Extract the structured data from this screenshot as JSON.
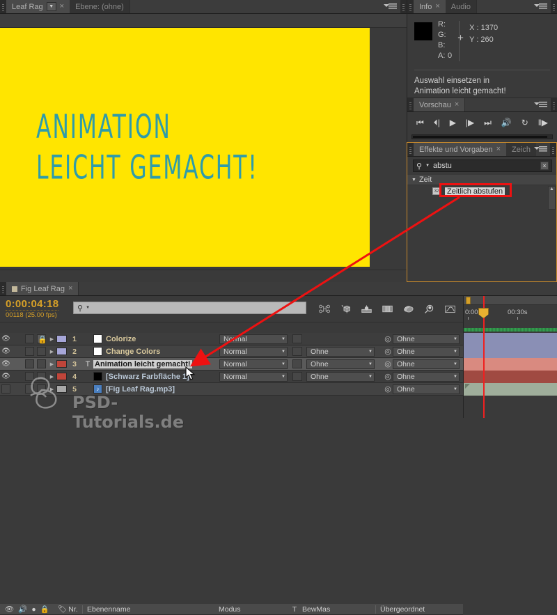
{
  "viewer": {
    "comp_tab": "Leaf Rag",
    "layer_tab": "Ebene: (ohne)",
    "close_glyph": "×",
    "caret_glyph": "▼",
    "comp_text_line1": "ANIMATION",
    "comp_text_line2": "LEICHT GEMACHT!",
    "bg_color": "#FFE500",
    "text_color": "#2E9CAA"
  },
  "info": {
    "tab": "Info",
    "tab_audio": "Audio",
    "close_glyph": "×",
    "r_label": "R:",
    "g_label": "G:",
    "b_label": "B:",
    "a_label": "A:",
    "r_value": "",
    "g_value": "",
    "b_value": "",
    "a_value": "0",
    "x_value": "X : 1370",
    "y_value": "Y : 260",
    "cross_glyph": "+",
    "message_line1": "Auswahl einsetzen in",
    "message_line2": "Animation leicht gemacht!",
    "swatch_color": "#000000"
  },
  "preview": {
    "tab": "Vorschau",
    "close_glyph": "×",
    "buttons": [
      {
        "name": "first-frame",
        "glyph": "⏮"
      },
      {
        "name": "prev-frame",
        "glyph": "⏴|"
      },
      {
        "name": "play",
        "glyph": "▶"
      },
      {
        "name": "next-frame",
        "glyph": "|▶"
      },
      {
        "name": "last-frame",
        "glyph": "⏭"
      },
      {
        "name": "audio",
        "glyph": "🔊"
      },
      {
        "name": "loop",
        "glyph": "↻"
      },
      {
        "name": "ram-preview",
        "glyph": "‖▶"
      }
    ]
  },
  "effects": {
    "tab": "Effekte und Vorgaben",
    "tab_inactive": "Zeich",
    "close_glyph": "×",
    "search_value": "abstu",
    "search_icon": "⚲",
    "search_caret": "▼",
    "clear_glyph": "×",
    "category": "Zeit",
    "category_tri": "▼",
    "item_name": "Zeitlich abstufen",
    "item_icon": "32",
    "scroll_up": "▲"
  },
  "timeline": {
    "tab": "Fig Leaf Rag",
    "close_glyph": "×",
    "timecode": "0:00:04:18",
    "frames": "00118 (25.00 fps)",
    "search_icon": "⚲",
    "search_caret": "▼",
    "search_value": "",
    "switch_icons": [
      "composition-nesting-icon",
      "draft-3d-icon",
      "motion-blur-icon",
      "frame-blending-icon",
      "shy-icon",
      "graph-editor-icon",
      "curve-editor-icon"
    ],
    "columns": {
      "eye": "eye-icon",
      "audio": "speaker-icon",
      "solo": "solo-icon",
      "lock": "lock-icon",
      "label": "label-tag-icon",
      "number": "Nr.",
      "layername": "Ebenenname",
      "modus": "Modus",
      "t": "T",
      "bewmas": "BewMas",
      "parent": "Übergeordnet"
    },
    "layers": [
      {
        "number": "1",
        "name": "Colorize",
        "name_style": "plain",
        "type_glyph": "",
        "source_color": "#ffffff",
        "label_color": "#a6a6d8",
        "locked": true,
        "visible": true,
        "modus": "Normal",
        "bewmas": "",
        "parent": "Ohne",
        "bar_color": "#8a8fb5"
      },
      {
        "number": "2",
        "name": "Change Colors",
        "name_style": "plain",
        "type_glyph": "",
        "source_color": "#ffffff",
        "label_color": "#a6a6d8",
        "locked": false,
        "visible": true,
        "modus": "Normal",
        "bewmas": "Ohne",
        "parent": "Ohne",
        "bar_color": "#8a8fb5"
      },
      {
        "number": "3",
        "name": "Animation leicht gemacht!",
        "name_style": "highlight",
        "type_glyph": "T",
        "source_color": "",
        "label_color": "#c0453a",
        "locked": false,
        "visible": true,
        "modus": "Normal",
        "bewmas": "Ohne",
        "parent": "Ohne",
        "bar_color": "#d98a80"
      },
      {
        "number": "4",
        "name": "[Schwarz Farbfläche 1]",
        "name_style": "bracket",
        "type_glyph": "",
        "source_color": "#000000",
        "label_color": "#c0453a",
        "locked": false,
        "visible": true,
        "modus": "Normal",
        "bewmas": "Ohne",
        "parent": "Ohne",
        "bar_color": "#a04a42"
      },
      {
        "number": "5",
        "name": "[Fig Leaf Rag.mp3]",
        "name_style": "bracket",
        "type_glyph": "",
        "source_color": "#4a7fc0",
        "label_color": "",
        "locked": false,
        "visible": false,
        "modus": "",
        "bewmas": "",
        "parent": "Ohne",
        "bar_color": "#9fae9b"
      }
    ],
    "ruler": {
      "labels": [
        "0:00",
        "00:30s"
      ],
      "playhead_time": "0:00:04:18"
    }
  },
  "annotations": {
    "highlight_target": "Zeitlich abstufen",
    "arrow_from": "effects-item-zeitlich-abstufen",
    "arrow_to": "layer-name-animation-leicht-gemacht",
    "color": "#ee1111"
  },
  "watermark": {
    "text": "PSD-Tutorials.de"
  }
}
